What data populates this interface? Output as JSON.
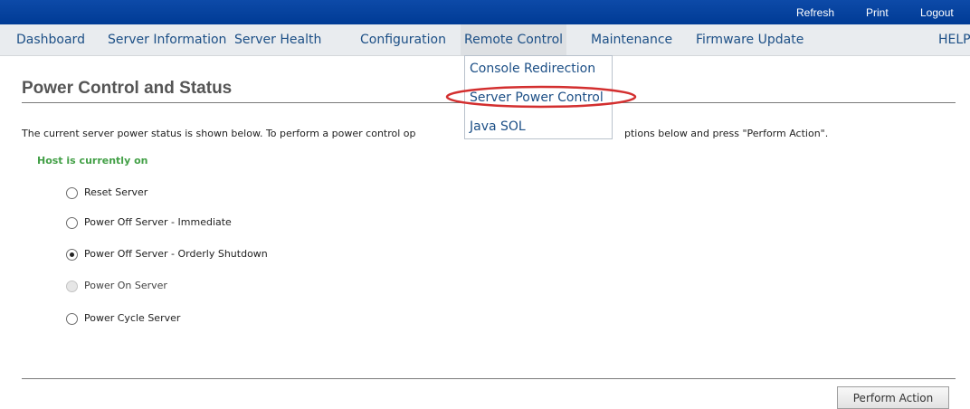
{
  "topbar": {
    "links": [
      "Refresh",
      "Print",
      "Logout"
    ]
  },
  "nav": {
    "items": [
      "Dashboard",
      "Server Information",
      "Server Health",
      "Configuration",
      "Remote Control",
      "Maintenance",
      "Firmware Update",
      "HELP"
    ],
    "active": "Remote Control"
  },
  "dropdown": {
    "items": [
      "Console Redirection",
      "Server Power Control",
      "Java SOL"
    ],
    "highlighted": "Server Power Control",
    "highlight_color": "#d32f2f"
  },
  "page": {
    "title": "Power Control and Status",
    "description_part1": "The current server power status is shown below. To perform a power control op",
    "description_part2": "ptions below and press \"Perform Action\".",
    "status": "Host is currently on",
    "status_color": "#43a047"
  },
  "options": [
    {
      "label": "Reset Server",
      "state": "unchecked"
    },
    {
      "label": "Power Off Server - Immediate",
      "state": "unchecked"
    },
    {
      "label": "Power Off Server - Orderly Shutdown",
      "state": "checked"
    },
    {
      "label": "Power On Server",
      "state": "disabled"
    },
    {
      "label": "Power Cycle Server",
      "state": "unchecked"
    }
  ],
  "action_button": {
    "label": "Perform Action"
  },
  "colors": {
    "topbar": "#003b95",
    "nav_text": "#1c4f86",
    "nav_bg": "#e9ecef"
  }
}
